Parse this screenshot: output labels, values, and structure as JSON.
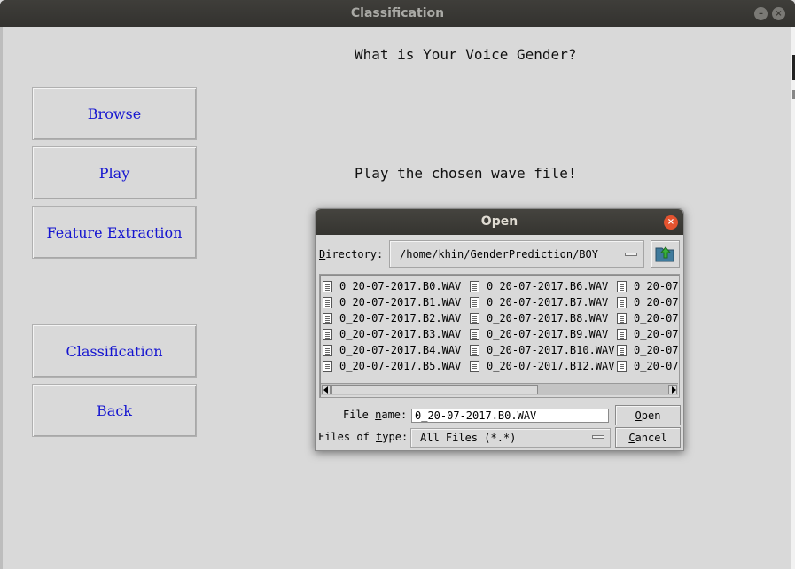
{
  "window": {
    "title": "Classification"
  },
  "app": {
    "buttons": [
      {
        "label": "Browse"
      },
      {
        "label": "Play"
      },
      {
        "label": "Feature Extraction"
      },
      {
        "label": "Classification"
      },
      {
        "label": "Back"
      }
    ],
    "question_label": "What is Your Voice Gender?",
    "status_label": "Play the chosen wave file!"
  },
  "dialog": {
    "title": "Open",
    "directory_label_first": "D",
    "directory_label_rest": "irectory:",
    "directory_value": "/home/khin/GenderPrediction/BOY",
    "files": {
      "col1": [
        "0_20-07-2017.B0.WAV",
        "0_20-07-2017.B1.WAV",
        "0_20-07-2017.B2.WAV",
        "0_20-07-2017.B3.WAV",
        "0_20-07-2017.B4.WAV",
        "0_20-07-2017.B5.WAV"
      ],
      "col2": [
        "0_20-07-2017.B6.WAV",
        "0_20-07-2017.B7.WAV",
        "0_20-07-2017.B8.WAV",
        "0_20-07-2017.B9.WAV",
        "0_20-07-2017.B10.WAV",
        "0_20-07-2017.B12.WAV"
      ],
      "col3": [
        "0_20-07",
        "0_20-07",
        "0_20-07",
        "0_20-07",
        "0_20-07",
        "0_20-07"
      ]
    },
    "file_name_label_a": "File ",
    "file_name_label_u": "n",
    "file_name_label_b": "ame:",
    "file_name_value": "0_20-07-2017.B0.WAV",
    "files_of_type_label_a": "Files of ",
    "files_of_type_label_u": "t",
    "files_of_type_label_b": "ype:",
    "files_of_type_value": "All Files (*.*)",
    "open_label_u": "O",
    "open_label_rest": "pen",
    "cancel_label_u": "C",
    "cancel_label_rest": "ancel"
  }
}
